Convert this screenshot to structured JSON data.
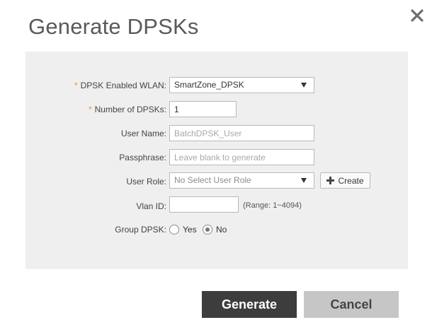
{
  "dialog": {
    "title": "Generate DPSKs",
    "close_icon": "close-icon"
  },
  "form": {
    "required_mark": "*",
    "wlan": {
      "label": "DPSK Enabled WLAN:",
      "value": "SmartZone_DPSK"
    },
    "num": {
      "label": "Number of DPSKs:",
      "value": "1"
    },
    "username": {
      "label": "User Name:",
      "placeholder": "BatchDPSK_User"
    },
    "passphrase": {
      "label": "Passphrase:",
      "placeholder": "Leave blank to generate"
    },
    "role": {
      "label": "User Role:",
      "value": "No Select User Role",
      "create_label": "Create",
      "create_icon": "plus-icon"
    },
    "vlan": {
      "label": "Vlan ID:",
      "value": "",
      "range": "(Range: 1~4094)"
    },
    "group": {
      "label": "Group DPSK:",
      "yes": "Yes",
      "no": "No",
      "selected": "No"
    }
  },
  "footer": {
    "generate_label": "Generate",
    "cancel_label": "Cancel"
  },
  "colors": {
    "required": "#f0902a",
    "primary_button": "#3d3d3d",
    "secondary_button": "#c6c6c6",
    "panel_bg": "#efefef"
  }
}
